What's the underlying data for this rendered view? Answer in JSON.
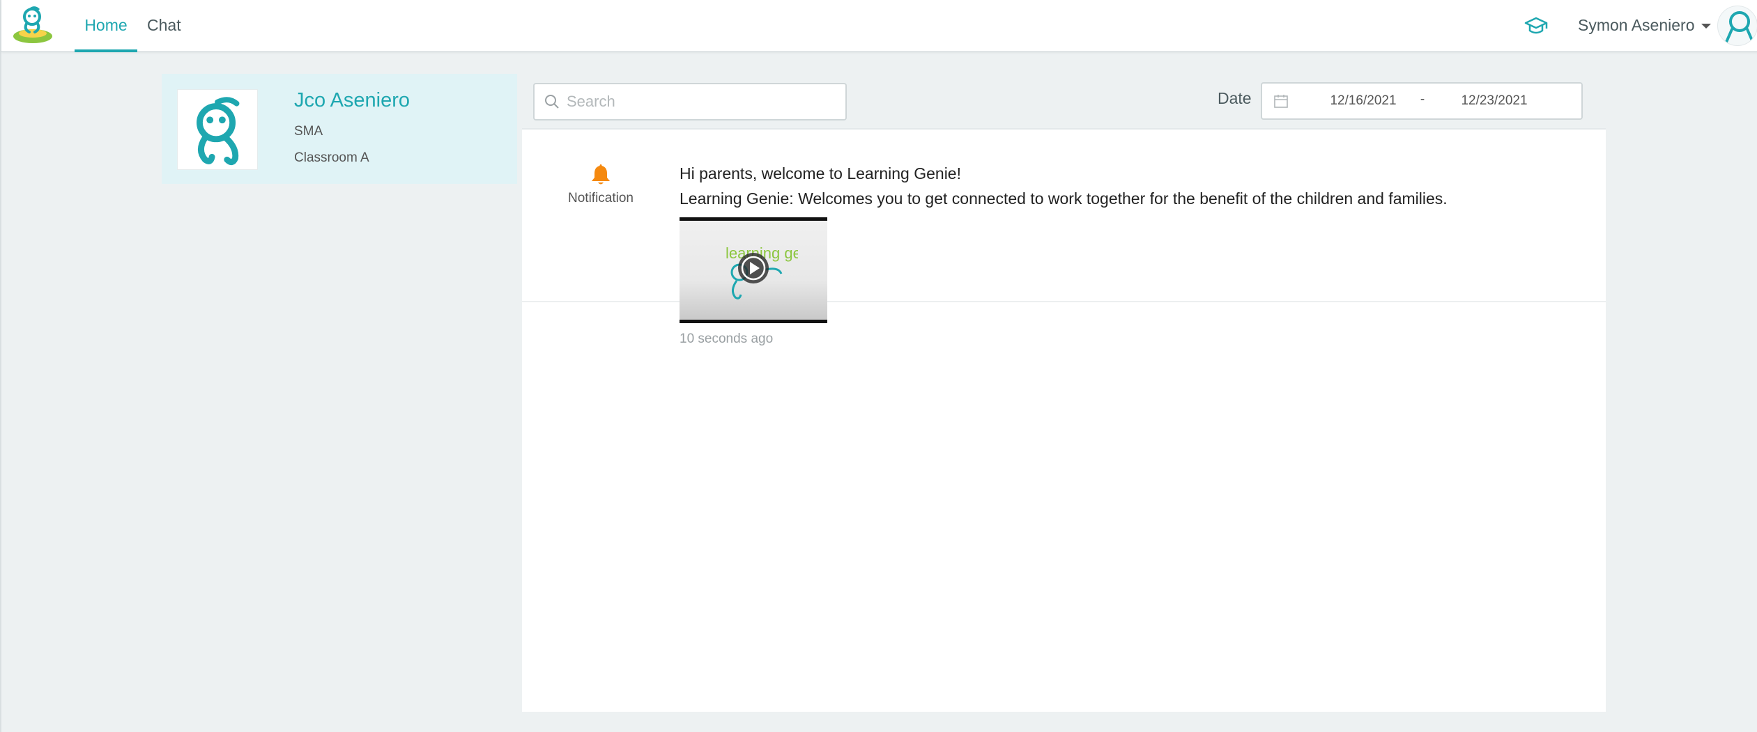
{
  "nav": {
    "home_label": "Home",
    "chat_label": "Chat",
    "user_name": "Symon Aseniero"
  },
  "profile": {
    "name": "Jco Aseniero",
    "school": "SMA",
    "classroom": "Classroom A"
  },
  "toolbar": {
    "search_placeholder": "Search",
    "date_label": "Date",
    "date_start": "12/16/2021",
    "date_separator": "-",
    "date_end": "12/23/2021"
  },
  "feed": [
    {
      "type_label": "Notification",
      "line1": "Hi parents, welcome to Learning Genie!",
      "line2": "Learning Genie: Welcomes you to get connected to work together for the benefit of the children and families.",
      "time": "10 seconds ago",
      "thumbnail_text": "learning genie"
    }
  ],
  "colors": {
    "accent": "#1ea7b0",
    "notification": "#f5890f",
    "background": "#edf1f2",
    "profile_bg": "#e0f3f6"
  },
  "icons": [
    "app-logo-icon",
    "graduation-cap-icon",
    "user-avatar-icon",
    "search-icon",
    "calendar-icon",
    "bell-icon",
    "play-icon"
  ]
}
